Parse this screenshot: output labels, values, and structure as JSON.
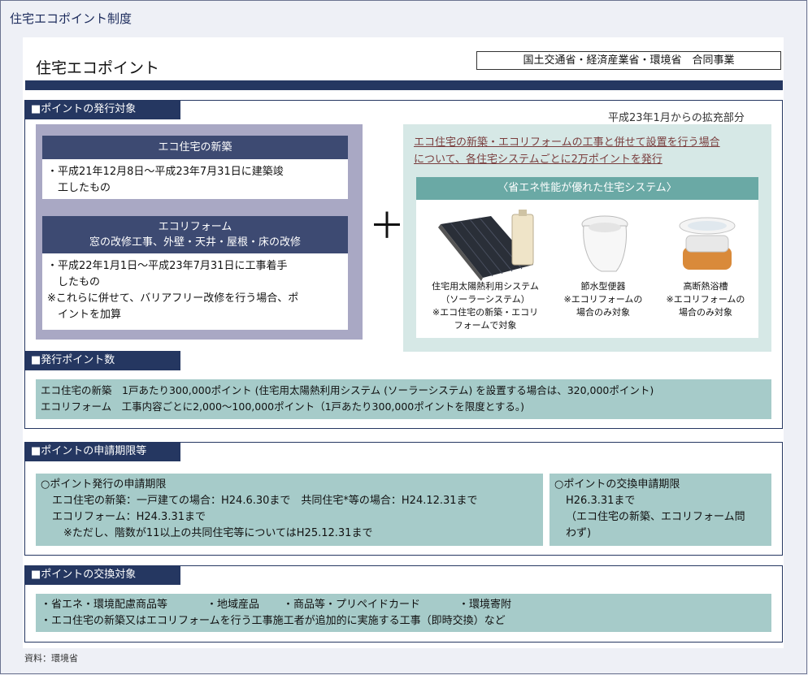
{
  "page_title": "住宅エコポイント制度",
  "system_title": "住宅エコポイント",
  "ministry_label": "国土交通省・経済産業省・環境省　合同事業",
  "sections": {
    "target": {
      "label": "■ポイントの発行対象",
      "new_build": {
        "title": "エコ住宅の新築",
        "line1": "・平成21年12月8日〜平成23年7月31日に建築竣",
        "line2": "　工したもの"
      },
      "reform": {
        "title1": "エコリフォーム",
        "title2": "窓の改修工事、外壁・天井・屋根・床の改修",
        "line1": "・平成22年1月1日〜平成23年7月31日に工事着手",
        "line2": "　したもの",
        "line3": "※これらに併せて、バリアフリー改修を行う場合、ポ",
        "line4": "　イントを加算"
      },
      "plus": "＋",
      "expansion_label": "平成23年1月からの拡充部分",
      "expansion_text1": "エコ住宅の新築・エコリフォームの工事と併せて設置を行う場合",
      "expansion_text2": "について、各住宅システムごとに2万ポイントを発行",
      "house_systems": {
        "header": "〈省エネ性能が優れた住宅システム〉",
        "solar": {
          "l1": "住宅用太陽熱利用システム",
          "l2": "（ソーラーシステム）",
          "l3": "※エコ住宅の新築・エコリ",
          "l4": "フォームで対象"
        },
        "toilet": {
          "l1": "節水型便器",
          "l2": "※エコリフォームの",
          "l3": "場合のみ対象"
        },
        "bathtub": {
          "l1": "高断熱浴槽",
          "l2": "※エコリフォームの",
          "l3": "場合のみ対象"
        }
      }
    },
    "points": {
      "label": "■発行ポイント数",
      "line1": "エコ住宅の新築　1戸あたり300,000ポイント (住宅用太陽熱利用システム (ソーラーシステム) を設置する場合は、320,000ポイント)",
      "line2": "エコリフォーム　工事内容ごとに2,000〜100,000ポイント（1戸あたり300,000ポイントを限度とする。)"
    },
    "period": {
      "label": "■ポイントの申請期限等",
      "left": {
        "title": "○ポイント発行の申請期限",
        "l1": "エコ住宅の新築：一戸建ての場合：H24.6.30まで　共同住宅*等の場合：H24.12.31まで",
        "l2": "エコリフォーム：H24.3.31まで",
        "l3": "※ただし、階数が11以上の共同住宅等についてはH25.12.31まで"
      },
      "right": {
        "title": "○ポイントの交換申請期限",
        "l1": "H26.3.31まで",
        "l2": "（エコ住宅の新築、エコリフォーム問",
        "l3": "わず)"
      }
    },
    "exchange": {
      "label": "■ポイントの交換対象",
      "items": [
        "・省エネ・環境配慮商品等",
        "・地域産品",
        "・商品等・プリペイドカード",
        "・環境寄附"
      ],
      "line2": "・エコ住宅の新築又はエコリフォームを行う工事施工者が追加的に実施する工事（即時交換）など"
    }
  },
  "source": "資料：環境省",
  "colors": {
    "navy": "#253761",
    "teal": "#a6cbc9",
    "lavender": "#a9a8c4"
  }
}
